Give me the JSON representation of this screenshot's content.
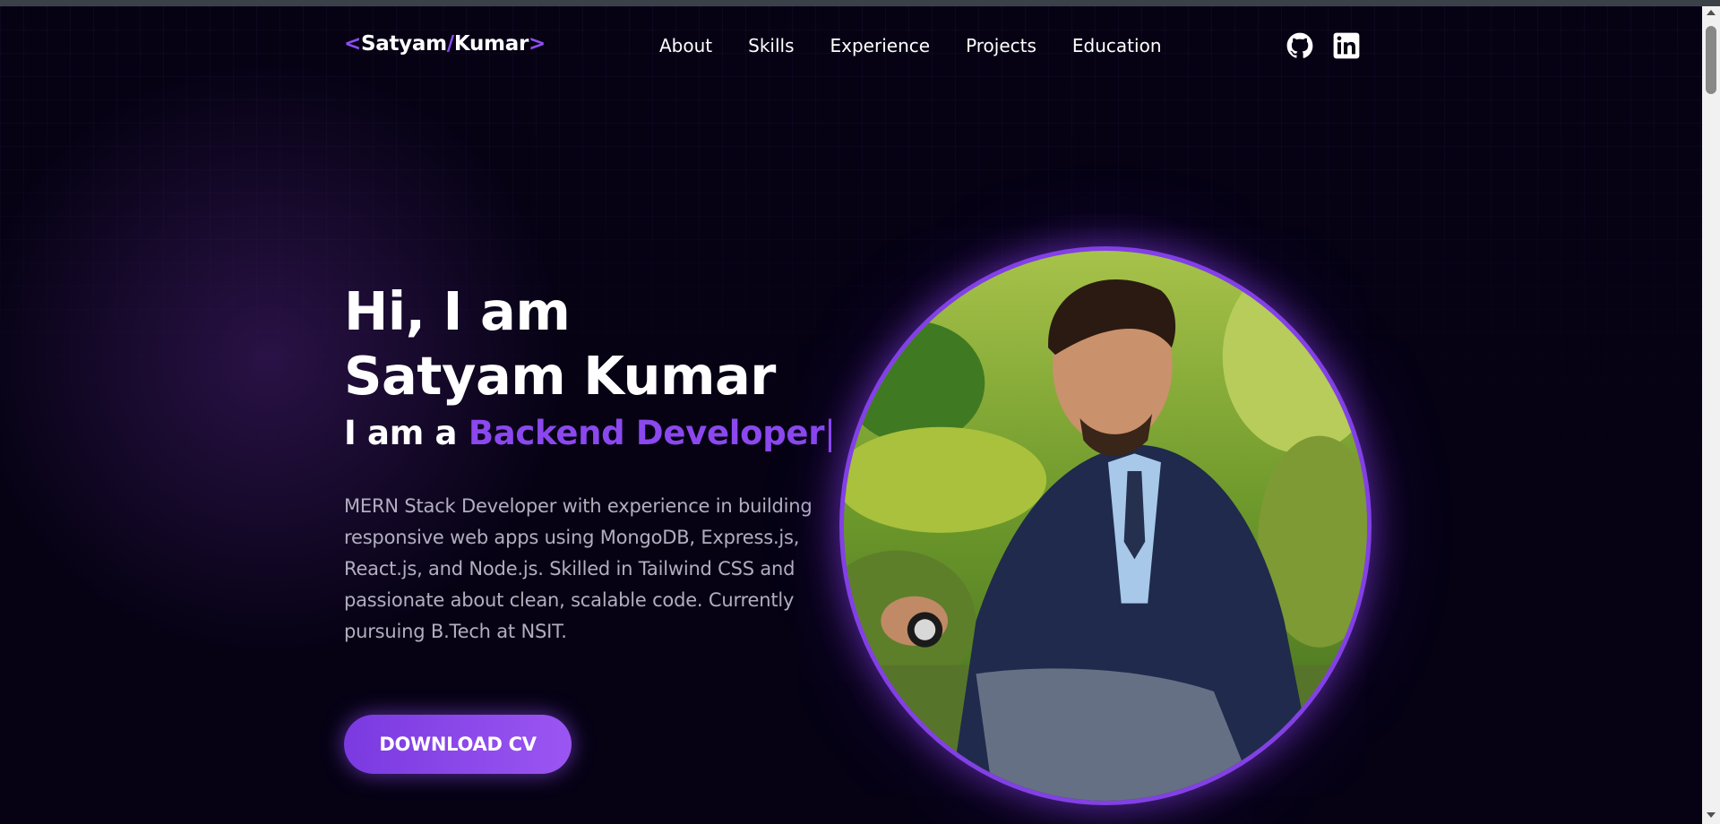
{
  "header": {
    "logo": {
      "open": "<",
      "first": "Satyam",
      "slash": "/",
      "last": "Kumar",
      "close": ">"
    },
    "nav": [
      "About",
      "Skills",
      "Experience",
      "Projects",
      "Education"
    ],
    "social": {
      "github_icon": "github-icon",
      "linkedin_icon": "linkedin-icon"
    }
  },
  "hero": {
    "greeting": "Hi, I am",
    "name": "Satyam Kumar",
    "role_prefix": "I am a ",
    "role": "Backend Developer",
    "cursor": "|",
    "description": "MERN Stack Developer with experience in building responsive web apps using MongoDB, Express.js, React.js, and Node.js. Skilled in Tailwind CSS and passionate about clean, scalable code. Currently pursuing B.Tech at NSIT.",
    "cta": "DOWNLOAD CV"
  },
  "colors": {
    "background": "#060214",
    "accent": "#8b48ee",
    "ring": "#8340e6",
    "text_muted": "#b2aec0"
  }
}
